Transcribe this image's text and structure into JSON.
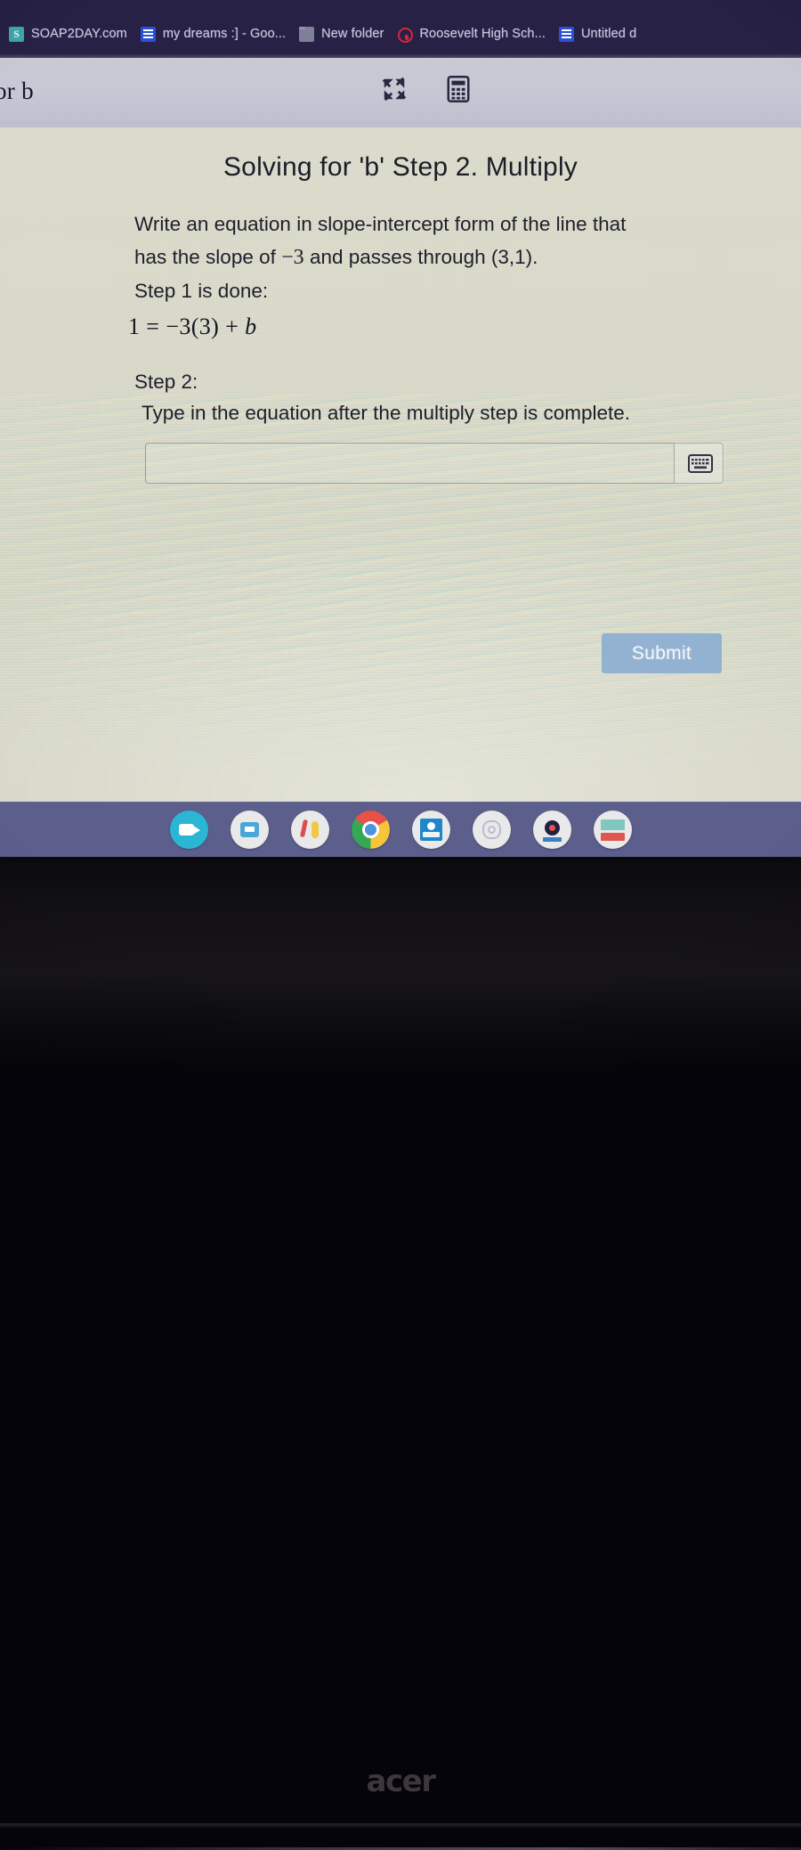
{
  "browser": {
    "bookmarks": [
      {
        "label": "SOAP2DAY.com",
        "icon": "soap2day-icon"
      },
      {
        "label": "my dreams :] - Goo...",
        "icon": "google-docs-icon"
      },
      {
        "label": "New folder",
        "icon": "folder-icon"
      },
      {
        "label": "Roosevelt High Sch...",
        "icon": "opera-ring-icon"
      },
      {
        "label": "Untitled d",
        "icon": "google-docs-icon"
      }
    ]
  },
  "toolbar": {
    "title": "or b",
    "fullscreen_label": "fullscreen-icon",
    "calculator_label": "calculator-icon"
  },
  "question": {
    "title": "Solving for 'b' Step 2. Multiply",
    "prompt_line1": "Write an equation in slope-intercept form of the line that",
    "prompt_line2_before": "has the slope of",
    "prompt_slope": "−3",
    "prompt_line2_after": "and passes through (3,1).",
    "step1_label": "Step 1 is done:",
    "step1_equation_lhs": "1 = −3(3) + ",
    "step1_equation_var": "b",
    "step2_label": "Step 2:",
    "step2_instruction": "Type in the equation after the multiply step is complete."
  },
  "answer": {
    "value": "",
    "placeholder": "",
    "keyboard_icon": "keyboard-icon",
    "submit_label": "Submit",
    "submit_color": "#93b2d2"
  },
  "shelf": {
    "icons": [
      {
        "name": "camera-app-icon",
        "active": false
      },
      {
        "name": "screencast-app-icon",
        "active": false
      },
      {
        "name": "paint-app-icon",
        "active": false
      },
      {
        "name": "chrome-app-icon",
        "active": true
      },
      {
        "name": "classroom-app-icon",
        "active": false
      },
      {
        "name": "flower-app-icon",
        "active": false
      },
      {
        "name": "settings-app-icon",
        "active": false
      },
      {
        "name": "quiz-app-icon",
        "active": false
      }
    ]
  },
  "device": {
    "brand": "acer"
  }
}
